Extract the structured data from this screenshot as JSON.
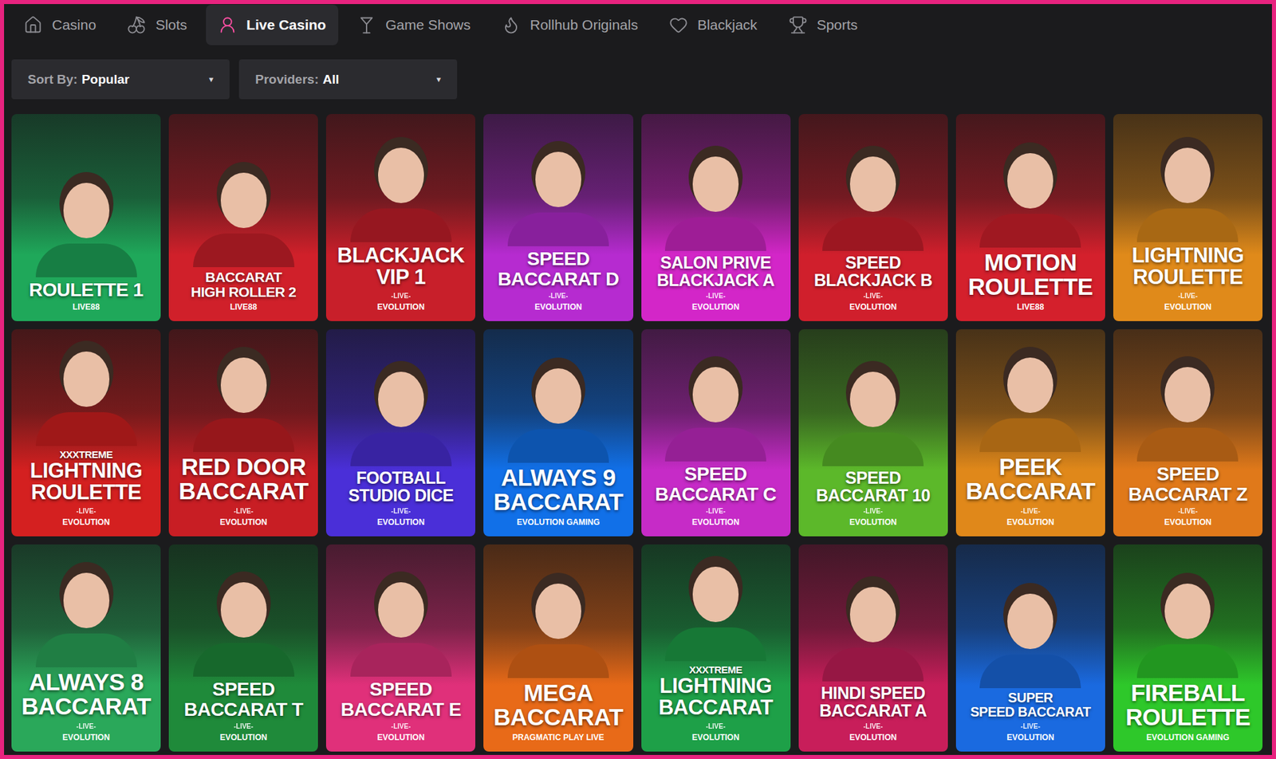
{
  "nav": {
    "tabs": [
      {
        "label": "Casino",
        "selected": false
      },
      {
        "label": "Slots",
        "selected": false
      },
      {
        "label": "Live Casino",
        "selected": true
      },
      {
        "label": "Game Shows",
        "selected": false
      },
      {
        "label": "Rollhub Originals",
        "selected": false
      },
      {
        "label": "Blackjack",
        "selected": false
      },
      {
        "label": "Sports",
        "selected": false
      }
    ]
  },
  "filters": [
    {
      "label": "Sort By:",
      "value": "Popular",
      "caret": "▾"
    },
    {
      "label": "Providers:",
      "value": "All",
      "caret": "▾"
    }
  ],
  "games": [
    {
      "title": [
        "ROULETTE 1"
      ],
      "provider": "LIVE88",
      "color": "#1fa85a"
    },
    {
      "title": [
        "BACCARAT",
        "HIGH ROLLER 2"
      ],
      "provider": "LIVE88",
      "color": "#d0202a"
    },
    {
      "title": [
        "BLACKJACK",
        "VIP 1"
      ],
      "live": "-LIVE-",
      "provider": "EVOLUTION",
      "color": "#c81f2a"
    },
    {
      "title": [
        "SPEED",
        "BACCARAT D"
      ],
      "live": "-LIVE-",
      "provider": "EVOLUTION",
      "color": "#b62bd0"
    },
    {
      "title": [
        "SALON PRIVE",
        "BLACKJACK A"
      ],
      "live": "-LIVE-",
      "provider": "EVOLUTION",
      "color": "#d326c8"
    },
    {
      "title": [
        "SPEED",
        "BLACKJACK B"
      ],
      "live": "-LIVE-",
      "provider": "EVOLUTION",
      "color": "#d01f2c"
    },
    {
      "title": [
        "MOTION",
        "ROULETTE"
      ],
      "provider": "LIVE88",
      "color": "#d4202c"
    },
    {
      "title": [
        "LIGHTNING",
        "ROULETTE"
      ],
      "live": "-LIVE-",
      "provider": "EVOLUTION",
      "color": "#e08a1a"
    },
    {
      "kicker": "XXXTREME",
      "title": [
        "LIGHTNING",
        "ROULETTE"
      ],
      "live": "-LIVE-",
      "provider": "EVOLUTION",
      "color": "#d42020"
    },
    {
      "title": [
        "RED DOOR",
        "BACCARAT"
      ],
      "live": "-LIVE-",
      "provider": "EVOLUTION",
      "color": "#c81e24"
    },
    {
      "title": [
        "FOOTBALL",
        "STUDIO DICE"
      ],
      "live": "-LIVE-",
      "provider": "EVOLUTION",
      "color": "#4a2fd8"
    },
    {
      "title": [
        "ALWAYS 9",
        "BACCARAT"
      ],
      "provider": "EVOLUTION GAMING",
      "color": "#1170e8"
    },
    {
      "title": [
        "SPEED",
        "BACCARAT C"
      ],
      "live": "-LIVE-",
      "provider": "EVOLUTION",
      "color": "#c62bc7"
    },
    {
      "title": [
        "SPEED",
        "BACCARAT 10"
      ],
      "live": "-LIVE-",
      "provider": "EVOLUTION",
      "color": "#5cb82a"
    },
    {
      "title": [
        "PEEK",
        "BACCARAT"
      ],
      "live": "-LIVE-",
      "provider": "EVOLUTION",
      "color": "#e0881a"
    },
    {
      "title": [
        "SPEED",
        "BACCARAT Z"
      ],
      "live": "-LIVE-",
      "provider": "EVOLUTION",
      "color": "#e0791a"
    },
    {
      "title": [
        "ALWAYS 8",
        "BACCARAT"
      ],
      "live": "-LIVE-",
      "provider": "EVOLUTION",
      "color": "#2aa85a"
    },
    {
      "title": [
        "SPEED",
        "BACCARAT T"
      ],
      "live": "-LIVE-",
      "provider": "EVOLUTION",
      "color": "#1f8a3a"
    },
    {
      "title": [
        "SPEED",
        "BACCARAT E"
      ],
      "live": "-LIVE-",
      "provider": "EVOLUTION",
      "color": "#e0307a"
    },
    {
      "title": [
        "MEGA",
        "BACCARAT"
      ],
      "provider": "PRAGMATIC PLAY LIVE",
      "color": "#e86a18"
    },
    {
      "kicker": "XXXTREME",
      "title": [
        "LIGHTNING",
        "BACCARAT"
      ],
      "live": "-LIVE-",
      "provider": "EVOLUTION",
      "color": "#1ea048"
    },
    {
      "title": [
        "HINDI SPEED",
        "BACCARAT A"
      ],
      "live": "-LIVE-",
      "provider": "EVOLUTION",
      "color": "#c81e5a"
    },
    {
      "title": [
        "SUPER",
        "SPEED BACCARAT"
      ],
      "live": "-LIVE-",
      "provider": "EVOLUTION",
      "color": "#1a6ae0"
    },
    {
      "title": [
        "FIREBALL",
        "ROULETTE"
      ],
      "provider": "EVOLUTION GAMING",
      "color": "#2ec82a"
    }
  ]
}
